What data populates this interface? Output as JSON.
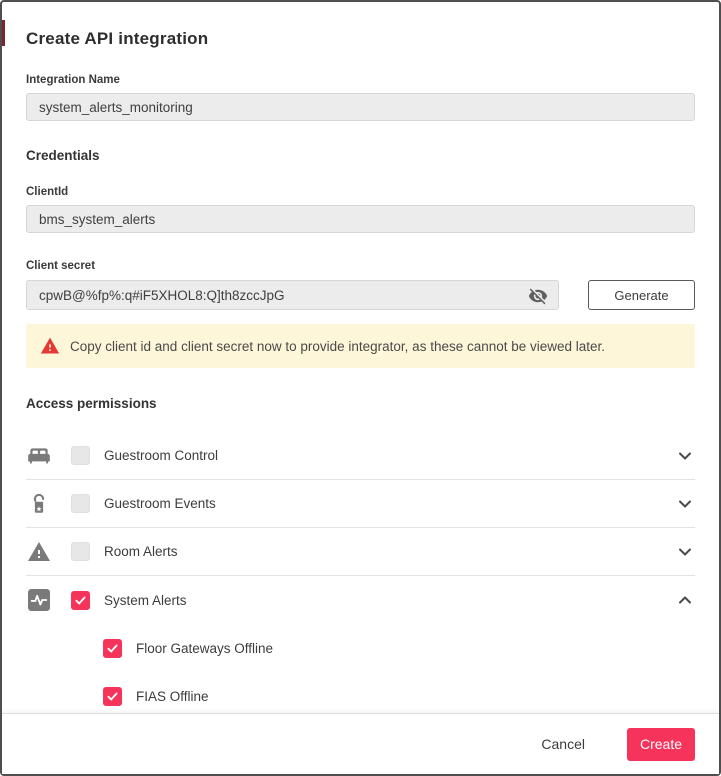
{
  "dialog": {
    "title": "Create API integration",
    "integration_name": {
      "label": "Integration Name",
      "value": "system_alerts_monitoring"
    },
    "credentials": {
      "heading": "Credentials",
      "client_id": {
        "label": "ClientId",
        "value": "bms_system_alerts"
      },
      "client_secret": {
        "label": "Client secret",
        "value": "cpwB@%fp%:q#iF5XHOL8:Q]th8zccJpG"
      },
      "generate_label": "Generate"
    },
    "warning_text": "Copy client id and client secret now to provide integrator, as these cannot be viewed later.",
    "permissions": {
      "heading": "Access permissions",
      "items": [
        {
          "label": "Guestroom Control",
          "icon": "bed-icon",
          "checked": false,
          "expanded": false
        },
        {
          "label": "Guestroom Events",
          "icon": "door-hanger-icon",
          "checked": false,
          "expanded": false
        },
        {
          "label": "Room Alerts",
          "icon": "warning-triangle-icon",
          "checked": false,
          "expanded": false
        },
        {
          "label": "System Alerts",
          "icon": "pulse-icon",
          "checked": true,
          "expanded": true,
          "children": [
            {
              "label": "Floor Gateways Offline",
              "checked": true
            },
            {
              "label": "FIAS Offline",
              "checked": true
            }
          ]
        }
      ]
    },
    "footer": {
      "cancel_label": "Cancel",
      "create_label": "Create"
    },
    "colors": {
      "accent": "#F5335B",
      "warning_bg": "#FDF6D8",
      "warning_icon": "#E53935",
      "icon_grey": "#7A7A7A"
    }
  }
}
